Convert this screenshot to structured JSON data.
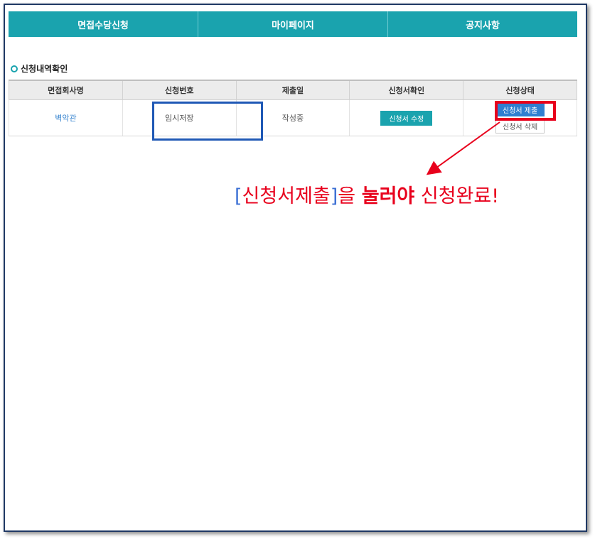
{
  "nav": {
    "tabs": [
      {
        "label": "면접수당신청"
      },
      {
        "label": "마이페이지"
      },
      {
        "label": "공지사항"
      }
    ]
  },
  "section": {
    "title": "신청내역확인"
  },
  "table": {
    "headers": [
      "면접회사명",
      "신청번호",
      "제출일",
      "신청서확인",
      "신청상태"
    ],
    "row": {
      "company": "벽악관",
      "application_no": "임시저장",
      "submit_date": "작성중",
      "edit_button": "신청서 수정",
      "submit_button": "신청서 제출",
      "delete_button": "신청서 삭제"
    }
  },
  "annotation": {
    "bracket_open": "[",
    "bracket_text": "신청서제출",
    "bracket_close": "]",
    "part1": "을 ",
    "strong": "눌러야",
    "part2": " 신청완료!"
  },
  "colors": {
    "accent": "#1aa3ae",
    "highlight_blue": "#1f58b5",
    "highlight_red": "#e8001c",
    "link": "#3a86d0"
  }
}
